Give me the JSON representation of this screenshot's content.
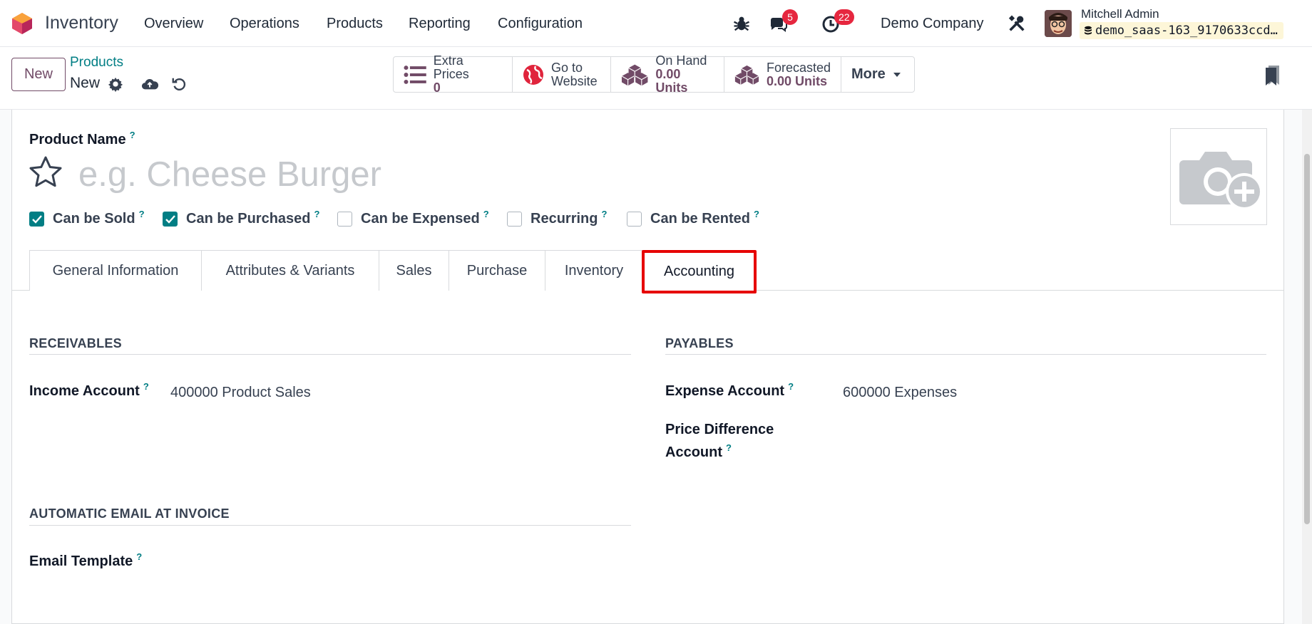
{
  "navbar": {
    "app_name": "Inventory",
    "menus": [
      "Overview",
      "Operations",
      "Products",
      "Reporting",
      "Configuration"
    ],
    "messages_count": "5",
    "activities_count": "22",
    "company": "Demo Company",
    "user_name": "Mitchell Admin",
    "database": "demo_saas-163_9170633ccd…"
  },
  "control_panel": {
    "new_label": "New",
    "breadcrumb_parent": "Products",
    "breadcrumb_current": "New",
    "stats": {
      "extra_prices_label": "Extra Prices",
      "extra_prices_value": "0",
      "website_label_1": "Go to",
      "website_label_2": "Website",
      "on_hand_label": "On Hand",
      "on_hand_value": "0.00 Units",
      "forecasted_label": "Forecasted",
      "forecasted_value": "0.00 Units",
      "more_label": "More"
    }
  },
  "form": {
    "product_name_label": "Product Name",
    "product_name_placeholder": "e.g. Cheese Burger",
    "tooltip_mark": "?",
    "checkboxes": [
      {
        "label": "Can be Sold",
        "checked": true
      },
      {
        "label": "Can be Purchased",
        "checked": true
      },
      {
        "label": "Can be Expensed",
        "checked": false
      },
      {
        "label": "Recurring",
        "checked": false
      },
      {
        "label": "Can be Rented",
        "checked": false
      }
    ],
    "tabs": [
      "General Information",
      "Attributes & Variants",
      "Sales",
      "Purchase",
      "Inventory",
      "Accounting"
    ],
    "active_tab": "Accounting",
    "receivables": {
      "title": "RECEIVABLES",
      "income_account_label": "Income Account",
      "income_account_value": "400000 Product Sales"
    },
    "payables": {
      "title": "PAYABLES",
      "expense_account_label": "Expense Account",
      "expense_account_value": "600000 Expenses",
      "price_diff_label_1": "Price Difference",
      "price_diff_label_2": "Account"
    },
    "email_section": {
      "title": "AUTOMATIC EMAIL AT INVOICE",
      "email_template_label": "Email Template"
    }
  },
  "colors": {
    "brand": "#714b67",
    "teal": "#017e84",
    "badge": "#e6273f",
    "highlight": "#e60000"
  }
}
